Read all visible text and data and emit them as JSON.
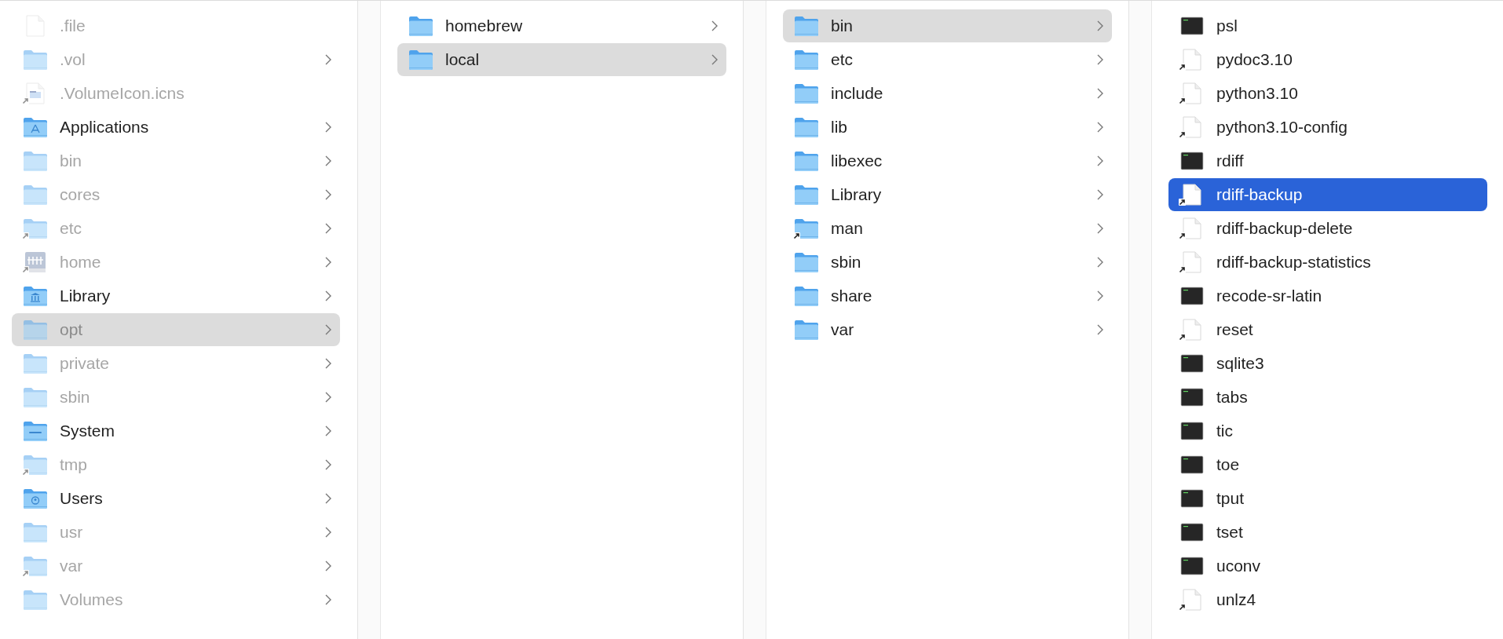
{
  "columns": [
    {
      "active": false,
      "items": [
        {
          "name": ".file",
          "kind": "document",
          "alias": false,
          "hidden": true,
          "expandable": false,
          "selected": false
        },
        {
          "name": ".vol",
          "kind": "folder",
          "alias": false,
          "hidden": true,
          "expandable": true,
          "selected": false
        },
        {
          "name": ".VolumeIcon.icns",
          "kind": "image-document",
          "alias": true,
          "hidden": true,
          "expandable": false,
          "selected": false
        },
        {
          "name": "Applications",
          "kind": "applications-folder",
          "alias": false,
          "hidden": false,
          "expandable": true,
          "selected": false
        },
        {
          "name": "bin",
          "kind": "folder",
          "alias": false,
          "hidden": true,
          "expandable": true,
          "selected": false
        },
        {
          "name": "cores",
          "kind": "folder",
          "alias": false,
          "hidden": true,
          "expandable": true,
          "selected": false
        },
        {
          "name": "etc",
          "kind": "folder",
          "alias": true,
          "hidden": true,
          "expandable": true,
          "selected": false
        },
        {
          "name": "home",
          "kind": "server-drive",
          "alias": true,
          "hidden": true,
          "expandable": true,
          "selected": false
        },
        {
          "name": "Library",
          "kind": "library-folder",
          "alias": false,
          "hidden": false,
          "expandable": true,
          "selected": false
        },
        {
          "name": "opt",
          "kind": "folder",
          "alias": false,
          "hidden": true,
          "expandable": true,
          "selected": true
        },
        {
          "name": "private",
          "kind": "folder",
          "alias": false,
          "hidden": true,
          "expandable": true,
          "selected": false
        },
        {
          "name": "sbin",
          "kind": "folder",
          "alias": false,
          "hidden": true,
          "expandable": true,
          "selected": false
        },
        {
          "name": "System",
          "kind": "system-folder",
          "alias": false,
          "hidden": false,
          "expandable": true,
          "selected": false
        },
        {
          "name": "tmp",
          "kind": "folder",
          "alias": true,
          "hidden": true,
          "expandable": true,
          "selected": false
        },
        {
          "name": "Users",
          "kind": "users-folder",
          "alias": false,
          "hidden": false,
          "expandable": true,
          "selected": false
        },
        {
          "name": "usr",
          "kind": "folder",
          "alias": false,
          "hidden": true,
          "expandable": true,
          "selected": false
        },
        {
          "name": "var",
          "kind": "folder",
          "alias": true,
          "hidden": true,
          "expandable": true,
          "selected": false
        },
        {
          "name": "Volumes",
          "kind": "folder",
          "alias": false,
          "hidden": true,
          "expandable": true,
          "selected": false
        }
      ]
    },
    {
      "active": false,
      "items": [
        {
          "name": "homebrew",
          "kind": "folder",
          "alias": false,
          "hidden": false,
          "expandable": true,
          "selected": false
        },
        {
          "name": "local",
          "kind": "folder",
          "alias": false,
          "hidden": false,
          "expandable": true,
          "selected": true
        }
      ]
    },
    {
      "active": false,
      "items": [
        {
          "name": "bin",
          "kind": "folder",
          "alias": false,
          "hidden": false,
          "expandable": true,
          "selected": true
        },
        {
          "name": "etc",
          "kind": "folder",
          "alias": false,
          "hidden": false,
          "expandable": true,
          "selected": false
        },
        {
          "name": "include",
          "kind": "folder",
          "alias": false,
          "hidden": false,
          "expandable": true,
          "selected": false
        },
        {
          "name": "lib",
          "kind": "folder",
          "alias": false,
          "hidden": false,
          "expandable": true,
          "selected": false
        },
        {
          "name": "libexec",
          "kind": "folder",
          "alias": false,
          "hidden": false,
          "expandable": true,
          "selected": false
        },
        {
          "name": "Library",
          "kind": "folder",
          "alias": false,
          "hidden": false,
          "expandable": true,
          "selected": false
        },
        {
          "name": "man",
          "kind": "folder",
          "alias": true,
          "hidden": false,
          "expandable": true,
          "selected": false
        },
        {
          "name": "sbin",
          "kind": "folder",
          "alias": false,
          "hidden": false,
          "expandable": true,
          "selected": false
        },
        {
          "name": "share",
          "kind": "folder",
          "alias": false,
          "hidden": false,
          "expandable": true,
          "selected": false
        },
        {
          "name": "var",
          "kind": "folder",
          "alias": false,
          "hidden": false,
          "expandable": true,
          "selected": false
        }
      ]
    },
    {
      "active": true,
      "items": [
        {
          "name": "psl",
          "kind": "executable",
          "alias": false,
          "hidden": false,
          "expandable": false,
          "selected": false
        },
        {
          "name": "pydoc3.10",
          "kind": "document",
          "alias": true,
          "hidden": false,
          "expandable": false,
          "selected": false
        },
        {
          "name": "python3.10",
          "kind": "document",
          "alias": true,
          "hidden": false,
          "expandable": false,
          "selected": false
        },
        {
          "name": "python3.10-config",
          "kind": "document",
          "alias": true,
          "hidden": false,
          "expandable": false,
          "selected": false
        },
        {
          "name": "rdiff",
          "kind": "executable",
          "alias": false,
          "hidden": false,
          "expandable": false,
          "selected": false
        },
        {
          "name": "rdiff-backup",
          "kind": "document",
          "alias": true,
          "hidden": false,
          "expandable": false,
          "selected": true
        },
        {
          "name": "rdiff-backup-delete",
          "kind": "document",
          "alias": true,
          "hidden": false,
          "expandable": false,
          "selected": false
        },
        {
          "name": "rdiff-backup-statistics",
          "kind": "document",
          "alias": true,
          "hidden": false,
          "expandable": false,
          "selected": false
        },
        {
          "name": "recode-sr-latin",
          "kind": "executable",
          "alias": false,
          "hidden": false,
          "expandable": false,
          "selected": false
        },
        {
          "name": "reset",
          "kind": "document",
          "alias": true,
          "hidden": false,
          "expandable": false,
          "selected": false
        },
        {
          "name": "sqlite3",
          "kind": "executable",
          "alias": false,
          "hidden": false,
          "expandable": false,
          "selected": false
        },
        {
          "name": "tabs",
          "kind": "executable",
          "alias": false,
          "hidden": false,
          "expandable": false,
          "selected": false
        },
        {
          "name": "tic",
          "kind": "executable",
          "alias": false,
          "hidden": false,
          "expandable": false,
          "selected": false
        },
        {
          "name": "toe",
          "kind": "executable",
          "alias": false,
          "hidden": false,
          "expandable": false,
          "selected": false
        },
        {
          "name": "tput",
          "kind": "executable",
          "alias": false,
          "hidden": false,
          "expandable": false,
          "selected": false
        },
        {
          "name": "tset",
          "kind": "executable",
          "alias": false,
          "hidden": false,
          "expandable": false,
          "selected": false
        },
        {
          "name": "uconv",
          "kind": "executable",
          "alias": false,
          "hidden": false,
          "expandable": false,
          "selected": false
        },
        {
          "name": "unlz4",
          "kind": "document",
          "alias": true,
          "hidden": false,
          "expandable": false,
          "selected": false
        }
      ]
    }
  ]
}
